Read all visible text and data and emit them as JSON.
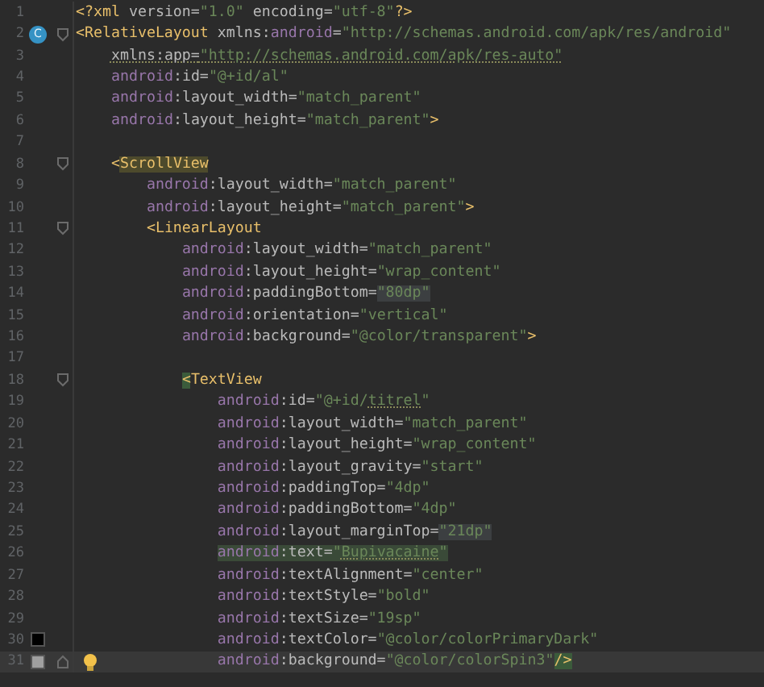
{
  "lines": [
    {
      "number": "1",
      "tokens": [
        {
          "kind": "tag",
          "text": "<?xml"
        },
        {
          "kind": "attr",
          "text": " version="
        },
        {
          "kind": "string",
          "text": "\"1.0\""
        },
        {
          "kind": "attr",
          "text": " encoding="
        },
        {
          "kind": "string",
          "text": "\"utf-8\""
        },
        {
          "kind": "tag",
          "text": "?>"
        }
      ]
    },
    {
      "number": "2",
      "badge": "C",
      "fold_start": true,
      "tokens": [
        {
          "kind": "tag",
          "text": "<RelativeLayout"
        },
        {
          "kind": "attr",
          "text": " xmlns:"
        },
        {
          "kind": "ns",
          "text": "android"
        },
        {
          "kind": "attr",
          "text": "="
        },
        {
          "kind": "string",
          "text": "\"http://schemas.android.com/apk/res/android\""
        }
      ]
    },
    {
      "number": "3",
      "tokens": [
        {
          "kind": "attr",
          "text": "    xmlns:app=",
          "underline": true
        },
        {
          "kind": "string",
          "text": "\"http://schemas.android.com/apk/res-auto\"",
          "underline": true
        }
      ]
    },
    {
      "number": "4",
      "tokens": [
        {
          "kind": "ns",
          "text": "    android"
        },
        {
          "kind": "attr",
          "text": ":id="
        },
        {
          "kind": "string",
          "text": "\"@+id/al\""
        }
      ]
    },
    {
      "number": "5",
      "tokens": [
        {
          "kind": "ns",
          "text": "    android"
        },
        {
          "kind": "attr",
          "text": ":layout_width="
        },
        {
          "kind": "string",
          "text": "\"match_parent\""
        }
      ]
    },
    {
      "number": "6",
      "tokens": [
        {
          "kind": "ns",
          "text": "    android"
        },
        {
          "kind": "attr",
          "text": ":layout_height="
        },
        {
          "kind": "string",
          "text": "\"match_parent\""
        },
        {
          "kind": "tag",
          "text": ">"
        }
      ]
    },
    {
      "number": "7"
    },
    {
      "number": "8",
      "fold_start": true,
      "tokens": [
        {
          "kind": "tag",
          "text": "    <"
        },
        {
          "kind": "tag",
          "text": "ScrollView",
          "usage_highlight": true
        }
      ]
    },
    {
      "number": "9",
      "tokens": [
        {
          "kind": "ns",
          "text": "        android"
        },
        {
          "kind": "attr",
          "text": ":layout_width="
        },
        {
          "kind": "string",
          "text": "\"match_parent\""
        }
      ]
    },
    {
      "number": "10",
      "tokens": [
        {
          "kind": "ns",
          "text": "        android"
        },
        {
          "kind": "attr",
          "text": ":layout_height="
        },
        {
          "kind": "string",
          "text": "\"match_parent\""
        },
        {
          "kind": "tag",
          "text": ">"
        }
      ]
    },
    {
      "number": "11",
      "fold_start": true,
      "tokens": [
        {
          "kind": "tag",
          "text": "        <LinearLayout"
        }
      ]
    },
    {
      "number": "12",
      "tokens": [
        {
          "kind": "ns",
          "text": "            android"
        },
        {
          "kind": "attr",
          "text": ":layout_width="
        },
        {
          "kind": "string",
          "text": "\"match_parent\""
        }
      ]
    },
    {
      "number": "13",
      "tokens": [
        {
          "kind": "ns",
          "text": "            android"
        },
        {
          "kind": "attr",
          "text": ":layout_height="
        },
        {
          "kind": "string",
          "text": "\"wrap_content\""
        }
      ]
    },
    {
      "number": "14",
      "tokens": [
        {
          "kind": "ns",
          "text": "            android"
        },
        {
          "kind": "attr",
          "text": ":paddingBottom="
        },
        {
          "kind": "string",
          "text": "\"80dp\"",
          "shaded": true
        }
      ]
    },
    {
      "number": "15",
      "tokens": [
        {
          "kind": "ns",
          "text": "            android"
        },
        {
          "kind": "attr",
          "text": ":orientation="
        },
        {
          "kind": "string",
          "text": "\"vertical\""
        }
      ]
    },
    {
      "number": "16",
      "tokens": [
        {
          "kind": "ns",
          "text": "            android"
        },
        {
          "kind": "attr",
          "text": ":background="
        },
        {
          "kind": "string",
          "text": "\"@color/transparent\""
        },
        {
          "kind": "tag",
          "text": ">"
        }
      ]
    },
    {
      "number": "17"
    },
    {
      "number": "18",
      "fold_start": true,
      "tokens": [
        {
          "kind": "tag",
          "text": "            <",
          "brace_match": true
        },
        {
          "kind": "tag",
          "text": "TextView"
        }
      ]
    },
    {
      "number": "19",
      "tokens": [
        {
          "kind": "ns",
          "text": "                android"
        },
        {
          "kind": "attr",
          "text": ":id="
        },
        {
          "kind": "string",
          "text": "\"@+id/"
        },
        {
          "kind": "string",
          "text": "titrel",
          "underline": true
        },
        {
          "kind": "string",
          "text": "\""
        }
      ]
    },
    {
      "number": "20",
      "tokens": [
        {
          "kind": "ns",
          "text": "                android"
        },
        {
          "kind": "attr",
          "text": ":layout_width="
        },
        {
          "kind": "string",
          "text": "\"match_parent\""
        }
      ]
    },
    {
      "number": "21",
      "tokens": [
        {
          "kind": "ns",
          "text": "                android"
        },
        {
          "kind": "attr",
          "text": ":layout_height="
        },
        {
          "kind": "string",
          "text": "\"wrap_content\""
        }
      ]
    },
    {
      "number": "22",
      "tokens": [
        {
          "kind": "ns",
          "text": "                android"
        },
        {
          "kind": "attr",
          "text": ":layout_gravity="
        },
        {
          "kind": "string",
          "text": "\"start\""
        }
      ]
    },
    {
      "number": "23",
      "tokens": [
        {
          "kind": "ns",
          "text": "                android"
        },
        {
          "kind": "attr",
          "text": ":paddingTop="
        },
        {
          "kind": "string",
          "text": "\"4dp\""
        }
      ]
    },
    {
      "number": "24",
      "tokens": [
        {
          "kind": "ns",
          "text": "                android"
        },
        {
          "kind": "attr",
          "text": ":paddingBottom="
        },
        {
          "kind": "string",
          "text": "\"4dp\""
        }
      ]
    },
    {
      "number": "25",
      "tokens": [
        {
          "kind": "ns",
          "text": "                android"
        },
        {
          "kind": "attr",
          "text": ":layout_marginTop="
        },
        {
          "kind": "string",
          "text": "\"21dp\"",
          "shaded": true
        }
      ]
    },
    {
      "number": "26",
      "highlighted": true,
      "tokens": [
        {
          "kind": "ns",
          "text": "                android"
        },
        {
          "kind": "attr",
          "text": ":text="
        },
        {
          "kind": "string",
          "text": "\""
        },
        {
          "kind": "string",
          "text": "Bupivacaine",
          "underline": true
        },
        {
          "kind": "string",
          "text": "\""
        }
      ]
    },
    {
      "number": "27",
      "tokens": [
        {
          "kind": "ns",
          "text": "                android"
        },
        {
          "kind": "attr",
          "text": ":textAlignment="
        },
        {
          "kind": "string",
          "text": "\"center\""
        }
      ]
    },
    {
      "number": "28",
      "tokens": [
        {
          "kind": "ns",
          "text": "                android"
        },
        {
          "kind": "attr",
          "text": ":textStyle="
        },
        {
          "kind": "string",
          "text": "\"bold\""
        }
      ]
    },
    {
      "number": "29",
      "tokens": [
        {
          "kind": "ns",
          "text": "                android"
        },
        {
          "kind": "attr",
          "text": ":textSize="
        },
        {
          "kind": "string",
          "text": "\"19sp\""
        }
      ]
    },
    {
      "number": "30",
      "color": "#000000",
      "tokens": [
        {
          "kind": "ns",
          "text": "                android"
        },
        {
          "kind": "attr",
          "text": ":textColor="
        },
        {
          "kind": "string",
          "text": "\"@color/colorPrimaryDark\""
        }
      ]
    },
    {
      "number": "31",
      "color": "#a0a0a0",
      "fold_end": true,
      "bulb": true,
      "current": true,
      "tokens": [
        {
          "kind": "ns",
          "text": "                android"
        },
        {
          "kind": "attr",
          "text": ":background="
        },
        {
          "kind": "string",
          "text": "\"@color/colorSpin3\""
        },
        {
          "kind": "tag",
          "text": "/>",
          "brace_match": true
        }
      ]
    }
  ]
}
